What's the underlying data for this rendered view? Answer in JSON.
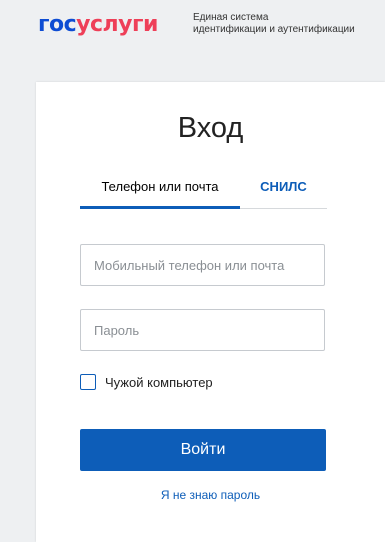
{
  "header": {
    "logo_part1": "гос",
    "logo_part2": "услуги",
    "tagline_line1": "Единая система",
    "tagline_line2": "идентификации и аутентификации"
  },
  "form": {
    "title": "Вход",
    "tabs": [
      {
        "label": "Телефон или почта",
        "active": true
      },
      {
        "label": "СНИЛС",
        "active": false
      }
    ],
    "phone_placeholder": "Мобильный телефон или почта",
    "password_placeholder": "Пароль",
    "checkbox_label": "Чужой компьютер",
    "checkbox_checked": false,
    "login_label": "Войти",
    "forgot_label": "Я не знаю пароль"
  },
  "colors": {
    "primary": "#0d5db8",
    "logo_blue": "#0d4cd3",
    "logo_red": "#ee3f58"
  }
}
